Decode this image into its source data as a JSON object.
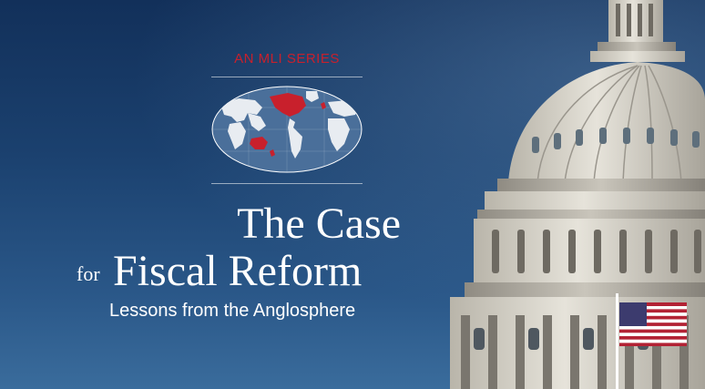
{
  "series": {
    "label": "AN MLI SERIES"
  },
  "title": {
    "line1": "The Case",
    "connector": "for",
    "line2": "Fiscal Reform",
    "subtitle": "Lessons from the Anglosphere"
  },
  "colors": {
    "accent_red": "#c8202c",
    "sky_blue": "#1b416f",
    "map_blue": "#4a6f9a",
    "dome_stone": "#d9d6cc"
  },
  "icons": {
    "map": "world-map-icon",
    "flag": "us-flag-icon"
  }
}
